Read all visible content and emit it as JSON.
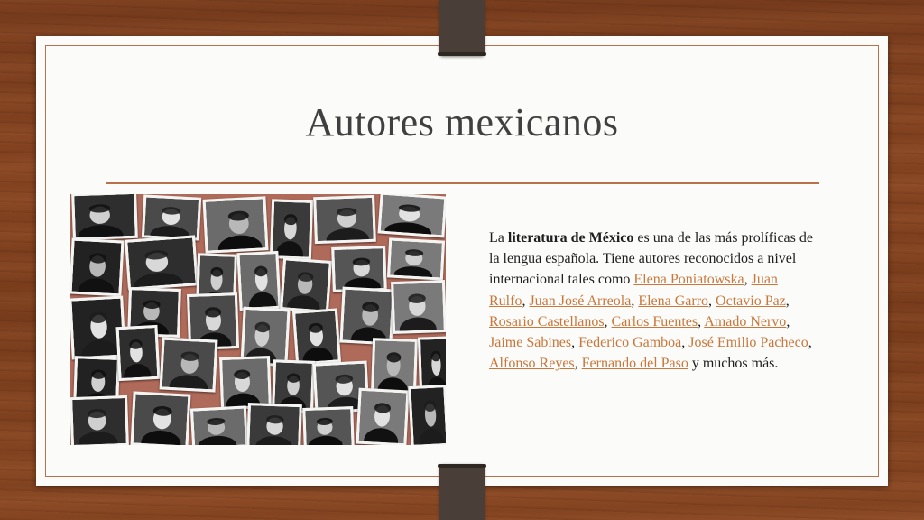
{
  "slide": {
    "title": "Autores mexicanos",
    "paragraph": {
      "intro_pre": "La ",
      "intro_bold": "literatura de México",
      "intro_post": " es una de las más prolíficas de la lengua española. Tiene autores reconocidos a nivel internacional tales como ",
      "authors": [
        "Elena Poniatowska",
        "Juan Rulfo",
        "Juan José Arreola",
        "Elena Garro",
        "Octavio Paz",
        "Rosario Castellanos",
        "Carlos Fuentes",
        "Amado Nervo",
        "Jaime Sabines",
        "Federico Gamboa",
        "José Emilio Pacheco",
        "Alfonso Reyes",
        "Fernando del Paso"
      ],
      "sep_comma": ", ",
      "outro": " y muchos más."
    }
  },
  "colors": {
    "accent_line": "#b9714b",
    "link": "#c9773a",
    "wood": "#7a3d1d",
    "collage_background": "#b06a5a"
  },
  "collage": {
    "image": "collage of black-and-white portrait photographs of Mexican authors"
  }
}
